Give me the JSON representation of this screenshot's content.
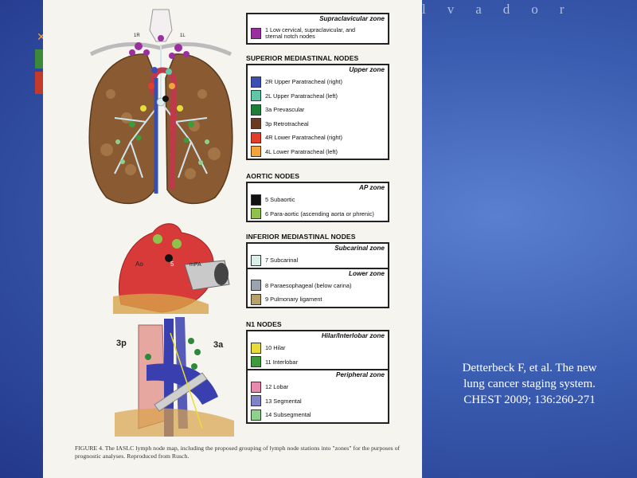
{
  "header_word": "lvador",
  "citation": {
    "line1": "Detterbeck F, et al. The new",
    "line2": "lung cancer staging system.",
    "line3": "CHEST 2009; 136:260-271"
  },
  "figure": {
    "illustration_labels": {
      "heart_ao": "Ao",
      "heart_5": "5",
      "heart_mpa": "mPA",
      "mediast_3p": "3p",
      "mediast_3a": "3a",
      "lung_1r": "1R",
      "lung_1l": "1L"
    },
    "supraclavicular": {
      "title": "Supraclavicular zone",
      "rows": [
        {
          "label_line1": "1 Low cervical, supraclavicular, and",
          "label_line2": "sternal notch nodes",
          "color": "#9b2fa0"
        }
      ]
    },
    "superior_header": "SUPERIOR MEDIASTINAL NODES",
    "upper_zone": {
      "title": "Upper zone",
      "rows": [
        {
          "label": "2R Upper Paratracheal (right)",
          "color": "#3b4fb5"
        },
        {
          "label": "2L Upper Paratracheal (left)",
          "color": "#5fc6a8"
        },
        {
          "label": "3a Prevascular",
          "color": "#1f7d3a"
        },
        {
          "label": "3p Retrotracheal",
          "color": "#6b3a20"
        },
        {
          "label": "4R Lower Paratracheal (right)",
          "color": "#e0402a"
        },
        {
          "label": "4L Lower Paratracheal (left)",
          "color": "#f2a43c"
        }
      ]
    },
    "aortic_header": "AORTIC NODES",
    "ap_zone": {
      "title": "AP zone",
      "rows": [
        {
          "label": "5 Subaortic",
          "color": "#111111"
        },
        {
          "label": "6 Para-aortic (ascending aorta or phrenic)",
          "color": "#8ec24a"
        }
      ]
    },
    "inferior_header": "INFERIOR MEDIASTINAL NODES",
    "subcarinal_zone": {
      "title": "Subcarinal zone",
      "rows": [
        {
          "label": "7 Subcarinal",
          "color": "#d8efea"
        }
      ]
    },
    "lower_zone": {
      "title": "Lower zone",
      "rows": [
        {
          "label": "8 Paraesophageal (below carina)",
          "color": "#9aa3ae"
        },
        {
          "label": "9 Pulmonary ligament",
          "color": "#b8a06a"
        }
      ]
    },
    "n1_header": "N1 NODES",
    "hilar_zone": {
      "title": "Hilar/Interlobar zone",
      "rows": [
        {
          "label": "10 Hilar",
          "color": "#e8dc3a"
        },
        {
          "label": "11 Interlobar",
          "color": "#3e9a3a"
        }
      ]
    },
    "peripheral_zone": {
      "title": "Peripheral zone",
      "rows": [
        {
          "label": "12 Lobar",
          "color": "#e88ab0"
        },
        {
          "label": "13 Segmental",
          "color": "#7f84c8"
        },
        {
          "label": "14 Subsegmental",
          "color": "#8fd08a"
        }
      ]
    },
    "caption": "FIGURE 4. The IASLC lymph node map, including the proposed grouping of lymph node stations into \"zones\" for the purposes of prognostic analyses. Reproduced from Rusch."
  }
}
